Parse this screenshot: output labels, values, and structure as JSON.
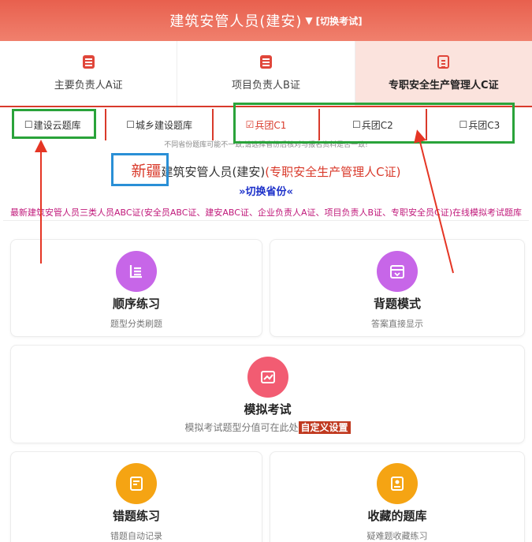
{
  "header": {
    "title": "建筑安管人员(建安)",
    "caret": "▼",
    "switch_label": "[切换考试]"
  },
  "cert_tabs": [
    {
      "label": "主要负责人A证",
      "icon": "document-icon"
    },
    {
      "label": "项目负责人B证",
      "icon": "document-icon"
    },
    {
      "label": "专职安全生产管理人C证",
      "icon": "document-icon"
    }
  ],
  "bank_tabs": [
    {
      "checkbox": "☐",
      "label": "建设云题库"
    },
    {
      "checkbox": "☐",
      "label": "城乡建设题库"
    },
    {
      "checkbox": "☑",
      "label": "兵团C1"
    },
    {
      "checkbox": "☐",
      "label": "兵团C2"
    },
    {
      "checkbox": "☐",
      "label": "兵团C3"
    }
  ],
  "notice": "不同省份题库可能不一致,请选择省份后核对与报名资料是否一致!",
  "province": {
    "name": "新疆",
    "exam": "建筑安管人员(建安)",
    "cert": "(专职安全生产管理人C证)",
    "switch_label": "»切换省份«"
  },
  "marquee": "最新建筑安管人员三类人员ABC证(安全员ABC证、建安ABC证、企业负责人A证、项目负责人B证、专职安全员C证)在线模拟考试题库",
  "cards": {
    "sequential": {
      "title": "顺序练习",
      "sub": "题型分类刷题",
      "icon": "list-icon"
    },
    "recite": {
      "title": "背题模式",
      "sub": "答案直接显示",
      "icon": "calendar-icon"
    },
    "mock": {
      "title": "模拟考试",
      "sub": "模拟考试题型分值可在此处",
      "custom": "自定义设置",
      "icon": "chart-icon"
    },
    "wrong": {
      "title": "错题练习",
      "sub": "错题自动记录",
      "icon": "edit-icon"
    },
    "favorite": {
      "title": "收藏的题库",
      "sub": "疑难题收藏练习",
      "icon": "bookmark-icon"
    }
  },
  "colors": {
    "header": "#e8604e",
    "accent": "#d93a2b",
    "purple": "#c766e8",
    "pink": "#f25c72",
    "orange": "#f5a413",
    "annotation_green": "#2aa33a",
    "annotation_blue": "#2a8fd6",
    "arrow_red": "#e53524"
  }
}
